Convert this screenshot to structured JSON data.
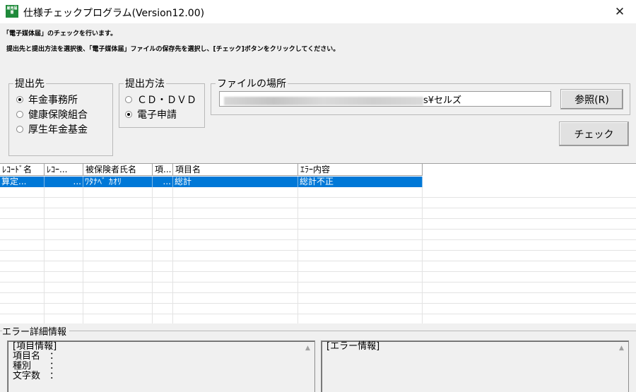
{
  "window": {
    "title": "仕様チェックプログラム(Version12.00)",
    "icon_text": "雇用届書",
    "close_glyph": "✕"
  },
  "info": {
    "line1": "「電子媒体届」のチェックを行います。",
    "line2": "提出先と提出方法を選択後、「電子媒体届」ファイルの保存先を選択し、[チェック]ボタンをクリックしてください。"
  },
  "destination": {
    "legend": "提出先",
    "options": [
      {
        "label": "年金事務所",
        "checked": true
      },
      {
        "label": "健康保険組合",
        "checked": false
      },
      {
        "label": "厚生年金基金",
        "checked": false
      }
    ]
  },
  "method": {
    "legend": "提出方法",
    "options": [
      {
        "label": "ＣＤ・ＤＶＤ",
        "checked": false
      },
      {
        "label": "電子申請",
        "checked": true
      }
    ]
  },
  "file": {
    "legend": "ファイルの場所",
    "path_suffix": "s¥セルズ",
    "browse_label": "参照(R)",
    "check_label": "チェック"
  },
  "grid": {
    "columns": [
      "ﾚｺｰﾄﾞ名",
      "ﾚｺｰ...",
      "被保険者氏名",
      "項...",
      "項目名",
      "ｴﾗｰ内容"
    ],
    "rows": [
      [
        "算定...",
        "...",
        "ﾜﾀﾅﾍﾞ ｶｵﾘ",
        "...",
        "総計",
        "総計不正"
      ]
    ]
  },
  "error_detail": {
    "legend": "エラー詳細情報",
    "item_pane": {
      "header": "[項目情報]",
      "lines": [
        "項目名　：",
        "種別　　：",
        "文字数　："
      ]
    },
    "error_pane": {
      "header": "[エラー情報]"
    }
  }
}
